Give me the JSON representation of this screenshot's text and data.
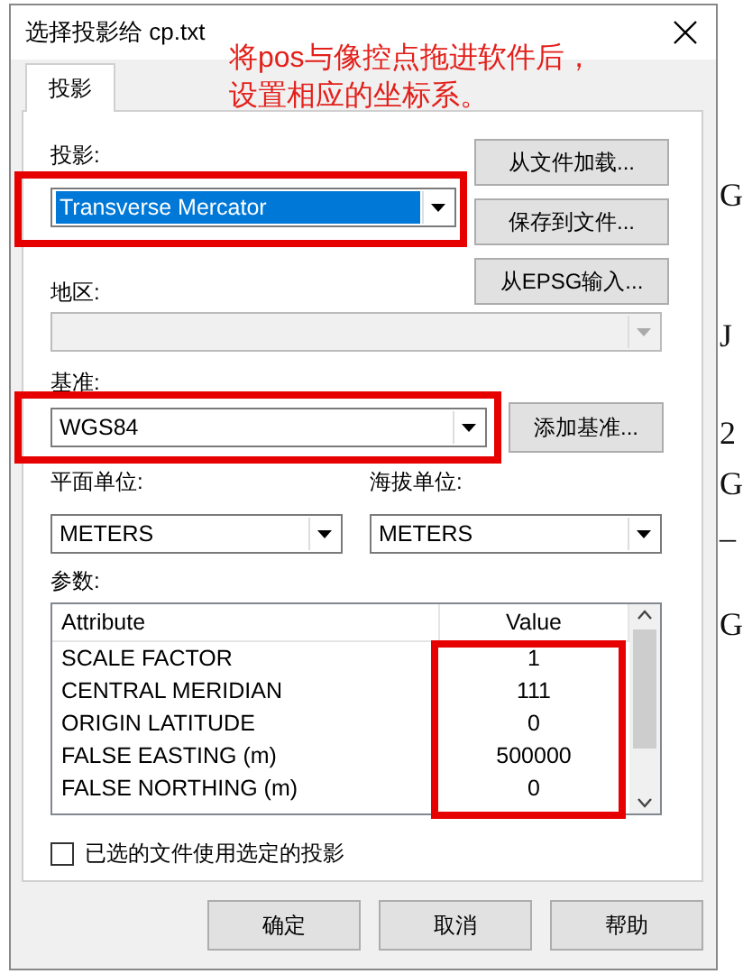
{
  "window": {
    "title": "选择投影给 cp.txt"
  },
  "annotation": {
    "lines": [
      "将pos与像控点拖进软件后，",
      "设置相应的坐标系。"
    ]
  },
  "tabs": [
    {
      "label": "投影",
      "selected": true
    }
  ],
  "projection": {
    "label": "投影:",
    "value": "Transverse Mercator",
    "highlighted": true
  },
  "side_buttons": [
    "从文件加载...",
    "保存到文件...",
    "从EPSG输入..."
  ],
  "region": {
    "label": "地区:",
    "disabled": true
  },
  "datum": {
    "label": "基准:",
    "value": "WGS84"
  },
  "add_datum_button": "添加基准...",
  "horizontal_units": {
    "label": "平面单位:",
    "value": "METERS"
  },
  "vertical_units": {
    "label": "海拔单位:",
    "value": "METERS"
  },
  "parameters": {
    "label": "参数:",
    "columns": [
      "Attribute",
      "Value"
    ],
    "rows": [
      {
        "attribute": "SCALE FACTOR",
        "value": "1"
      },
      {
        "attribute": "CENTRAL MERIDIAN",
        "value": "111"
      },
      {
        "attribute": "ORIGIN LATITUDE",
        "value": "0"
      },
      {
        "attribute": "FALSE EASTING (m)",
        "value": "500000"
      },
      {
        "attribute": "FALSE NORTHING (m)",
        "value": "0"
      }
    ]
  },
  "apply_checkbox": {
    "label": "已选的文件使用选定的投影",
    "checked": false
  },
  "buttons": [
    "确定",
    "取消",
    "帮助"
  ],
  "background_fragments": [
    "G",
    "J",
    "2",
    "G",
    "_",
    "G"
  ]
}
